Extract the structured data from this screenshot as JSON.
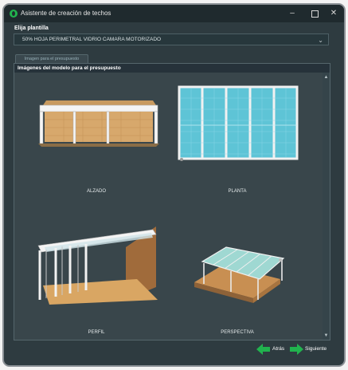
{
  "window": {
    "title": "Asistente de creación de techos",
    "accent": "#21b34e"
  },
  "template": {
    "label": "Elija plantilla",
    "selected": "50% HOJA PERIMETRAL VIDRIO CAMARA MOTORIZADO"
  },
  "tab": {
    "label": "Imagen para el presupuesto"
  },
  "panel": {
    "title": "Imágenes del modelo para el presupuesto",
    "images": [
      {
        "caption": "ALZADO"
      },
      {
        "caption": "PLANTA"
      },
      {
        "caption": "PERFIL"
      },
      {
        "caption": "PERSPECTIVA"
      }
    ]
  },
  "footer": {
    "back": "Atrás",
    "next": "Siguiente"
  }
}
